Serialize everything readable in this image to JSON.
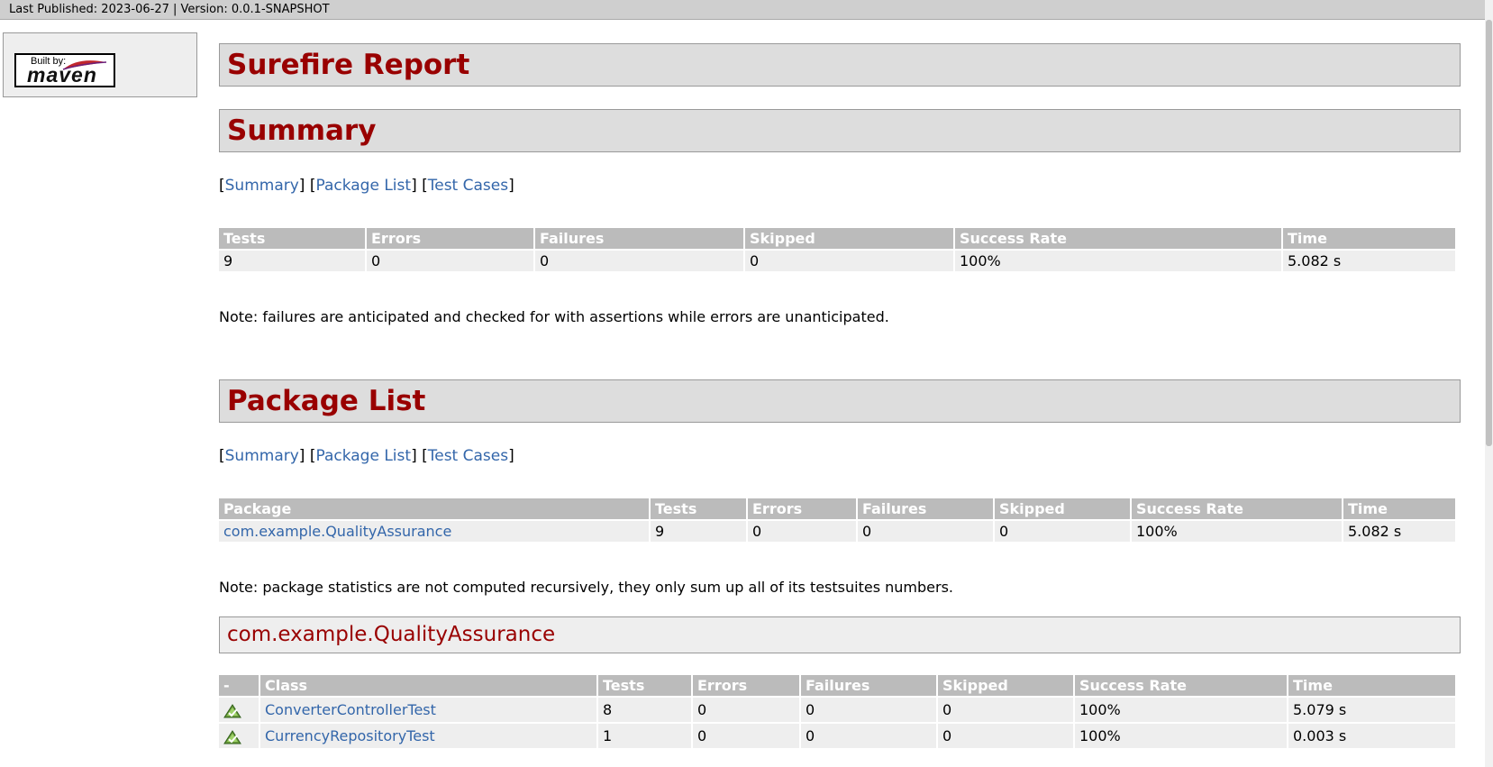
{
  "banner": {
    "published_label": "Last Published: 2023-06-27",
    "separator": "|",
    "version_label": "Version: 0.0.1-SNAPSHOT"
  },
  "logo": {
    "built_by": "Built by:",
    "name": "maven"
  },
  "report_title": "Surefire Report",
  "nav": {
    "summary": "Summary",
    "package_list": "Package List",
    "test_cases": "Test Cases"
  },
  "summary": {
    "heading": "Summary",
    "columns": [
      "Tests",
      "Errors",
      "Failures",
      "Skipped",
      "Success Rate",
      "Time"
    ],
    "row": [
      "9",
      "0",
      "0",
      "0",
      "100%",
      "5.082 s"
    ],
    "note": "Note: failures are anticipated and checked for with assertions while errors are unanticipated."
  },
  "package_list": {
    "heading": "Package List",
    "columns": [
      "Package",
      "Tests",
      "Errors",
      "Failures",
      "Skipped",
      "Success Rate",
      "Time"
    ],
    "row": [
      "com.example.QualityAssurance",
      "9",
      "0",
      "0",
      "0",
      "100%",
      "5.082 s"
    ],
    "note": "Note: package statistics are not computed recursively, they only sum up all of its testsuites numbers."
  },
  "package_detail": {
    "heading": "com.example.QualityAssurance",
    "columns": [
      "-",
      "Class",
      "Tests",
      "Errors",
      "Failures",
      "Skipped",
      "Success Rate",
      "Time"
    ],
    "rows": [
      [
        "ConverterControllerTest",
        "8",
        "0",
        "0",
        "0",
        "100%",
        "5.079 s"
      ],
      [
        "CurrencyRepositoryTest",
        "1",
        "0",
        "0",
        "0",
        "100%",
        "0.003 s"
      ]
    ]
  }
}
